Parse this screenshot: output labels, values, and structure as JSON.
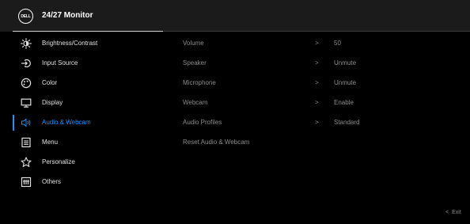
{
  "header": {
    "logo_text": "DELL",
    "title": "24/27 Monitor"
  },
  "menu": {
    "items": [
      {
        "label": "Brightness/Contrast",
        "icon": "brightness-icon"
      },
      {
        "label": "Input Source",
        "icon": "input-source-icon"
      },
      {
        "label": "Color",
        "icon": "color-icon"
      },
      {
        "label": "Display",
        "icon": "display-icon"
      },
      {
        "label": "Audio & Webcam",
        "icon": "audio-icon",
        "active": true
      },
      {
        "label": "Menu",
        "icon": "menu-icon"
      },
      {
        "label": "Personalize",
        "icon": "star-icon"
      },
      {
        "label": "Others",
        "icon": "others-icon"
      }
    ]
  },
  "submenu": {
    "items": [
      {
        "label": "Volume",
        "chevron": ">",
        "value": "50"
      },
      {
        "label": "Speaker",
        "chevron": ">",
        "value": "Unmute"
      },
      {
        "label": "Microphone",
        "chevron": ">",
        "value": "Unmute"
      },
      {
        "label": "Webcam",
        "chevron": ">",
        "value": "Enable"
      },
      {
        "label": "Audio Profiles",
        "chevron": ">",
        "value": "Standard"
      },
      {
        "label": "Reset Audio & Webcam",
        "chevron": "",
        "value": ""
      }
    ]
  },
  "footer": {
    "exit_chevron": "<",
    "exit_label": "Exit"
  },
  "colors": {
    "accent": "#1e90ff",
    "header_bg": "#1b1b1b",
    "background": "#000000",
    "dim_text": "#8c8c8c"
  }
}
